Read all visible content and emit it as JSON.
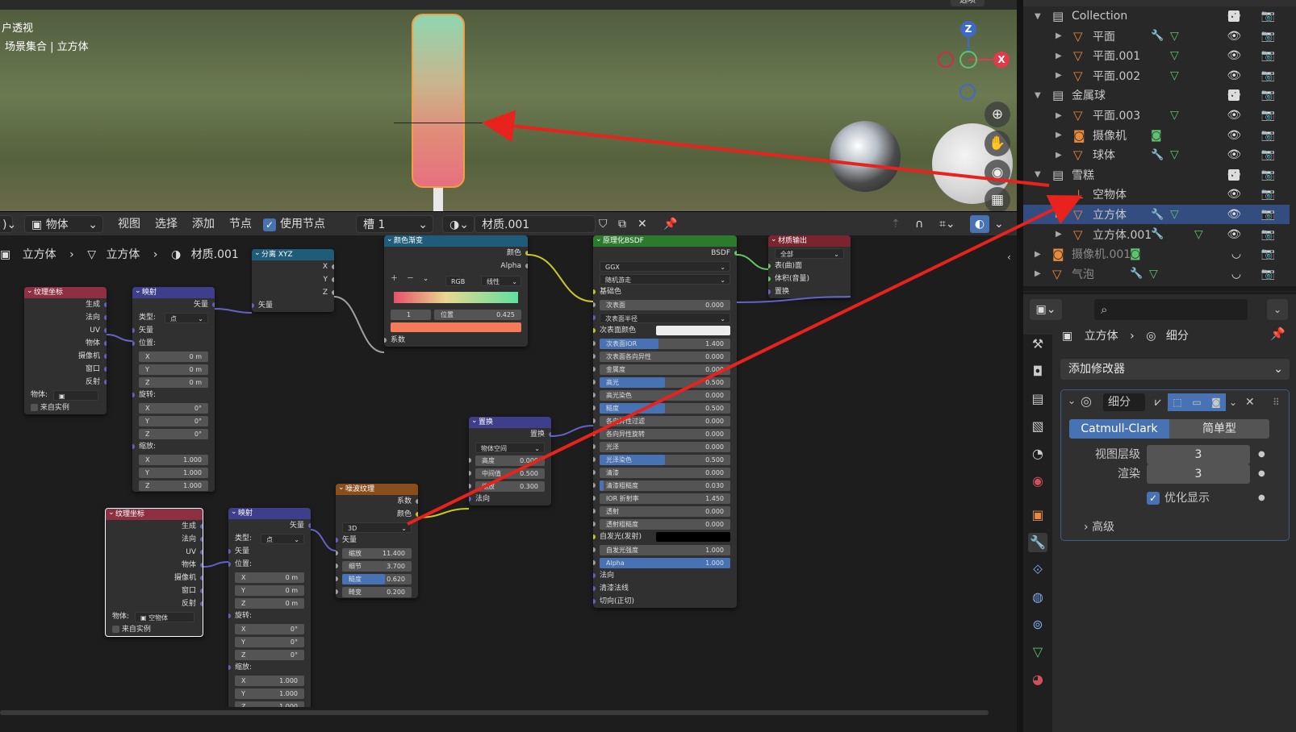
{
  "viewport": {
    "view_name": "户透视",
    "collection_path": "场景集合 | 立方体",
    "top_right_label": "选项",
    "gizmo": {
      "z": "Z",
      "x": "X"
    }
  },
  "outliner": {
    "rows": [
      {
        "name": "Collection",
        "type": "collection"
      },
      {
        "name": "平面",
        "type": "mesh"
      },
      {
        "name": "平面.001",
        "type": "mesh"
      },
      {
        "name": "平面.002",
        "type": "mesh"
      },
      {
        "name": "金属球",
        "type": "collection"
      },
      {
        "name": "平面.003",
        "type": "mesh"
      },
      {
        "name": "摄像机",
        "type": "camera"
      },
      {
        "name": "球体",
        "type": "mesh"
      },
      {
        "name": "雪糕",
        "type": "collection"
      },
      {
        "name": "空物体",
        "type": "empty"
      },
      {
        "name": "立方体",
        "type": "mesh",
        "selected": true
      },
      {
        "name": "立方体.001",
        "type": "mesh"
      },
      {
        "name": "摄像机.001",
        "type": "camera",
        "dim": true
      },
      {
        "name": "气泡",
        "type": "mesh",
        "dim": true
      }
    ]
  },
  "properties": {
    "breadcrumb_object": "立方体",
    "breadcrumb_modifier": "细分",
    "add_modifier": "添加修改器",
    "modifier_name": "细分",
    "mode_catmull": "Catmull-Clark",
    "mode_simple": "简单型",
    "viewport_levels_label": "视图层级",
    "viewport_levels_value": "3",
    "render_label": "渲染",
    "render_value": "3",
    "optimal_display": "优化显示",
    "advanced": "高级"
  },
  "node_header": {
    "object_mode": "物体",
    "menu": [
      "视图",
      "选择",
      "添加",
      "节点"
    ],
    "use_nodes": "使用节点",
    "slot": "槽 1",
    "material": "材质.001"
  },
  "breadcrumb": {
    "a": "立方体",
    "b": "立方体",
    "c": "材质.001"
  },
  "nodes": {
    "tex_coord1": {
      "title": "纹理坐标",
      "outputs": [
        "生成",
        "法向",
        "UV",
        "物体",
        "摄像机",
        "窗口",
        "反射"
      ],
      "object_label": "物体:",
      "from_instancer": "来自实例"
    },
    "mapping1": {
      "title": "映射",
      "out": "矢量",
      "type_label": "类型:",
      "type_value": "点",
      "in_vec": "矢量",
      "location": "位置:",
      "loc": [
        "0 m",
        "0 m",
        "0 m"
      ],
      "rotation": "旋转:",
      "rot": [
        "0°",
        "0°",
        "0°"
      ],
      "scale": "缩放:",
      "scl": [
        "1.000",
        "1.000",
        "1.000"
      ]
    },
    "sep_xyz": {
      "title": "分离 XYZ",
      "outs": [
        "X",
        "Y",
        "Z"
      ],
      "in": "矢量"
    },
    "color_ramp": {
      "title": "颜色渐变",
      "out_color": "颜色",
      "out_alpha": "Alpha",
      "mode": "RGB",
      "interp": "线性",
      "index": "1",
      "pos_label": "位置",
      "pos_value": "0.425",
      "in": "系数"
    },
    "bsdf": {
      "title": "原理化BSDF",
      "out": "BSDF",
      "dist": "GGX",
      "sss_method": "随机游走",
      "base_color": "基础色",
      "fields": [
        {
          "k": "次表面",
          "v": "0.000",
          "f": 0
        },
        {
          "k": "次表面半径",
          "v": "",
          "f": 0,
          "sel": true
        },
        {
          "k": "次表面颜色",
          "v": "",
          "f": 0,
          "color": "#ededed"
        },
        {
          "k": "次表面IOR",
          "v": "1.400",
          "f": 0.45
        },
        {
          "k": "次表面各向异性",
          "v": "0.000",
          "f": 0
        },
        {
          "k": "金属度",
          "v": "0.000",
          "f": 0
        },
        {
          "k": "高光",
          "v": "0.500",
          "f": 0.5
        },
        {
          "k": "高光染色",
          "v": "0.000",
          "f": 0
        },
        {
          "k": "糙度",
          "v": "0.500",
          "f": 0.5
        },
        {
          "k": "各向异性过滤",
          "v": "0.000",
          "f": 0
        },
        {
          "k": "各向异性旋转",
          "v": "0.000",
          "f": 0
        },
        {
          "k": "光泽",
          "v": "0.000",
          "f": 0
        },
        {
          "k": "光泽染色",
          "v": "0.500",
          "f": 0.5
        },
        {
          "k": "清漆",
          "v": "0.000",
          "f": 0
        },
        {
          "k": "清漆粗糙度",
          "v": "0.030",
          "f": 0.03
        },
        {
          "k": "IOR 折射率",
          "v": "1.450",
          "f": 0
        },
        {
          "k": "透射",
          "v": "0.000",
          "f": 0
        },
        {
          "k": "透射粗糙度",
          "v": "0.000",
          "f": 0
        },
        {
          "k": "自发光(发射)",
          "v": "",
          "f": 0,
          "color": "#000000"
        },
        {
          "k": "自发光强度",
          "v": "1.000",
          "f": 0
        },
        {
          "k": "Alpha",
          "v": "1.000",
          "f": 1
        }
      ],
      "tail": [
        "法向",
        "清漆法线",
        "切向(正切)"
      ]
    },
    "mat_out": {
      "title": "材质输出",
      "target": "全部",
      "ins": [
        "表(曲)面",
        "体积(音量)",
        "置换"
      ]
    },
    "displacement": {
      "title": "置换",
      "out": "置换",
      "space": "物体空间",
      "fields": [
        {
          "k": "高度",
          "v": "0.000"
        },
        {
          "k": "中间值",
          "v": "0.500"
        },
        {
          "k": "缩放",
          "v": "0.300"
        }
      ],
      "in": "法向"
    },
    "noise": {
      "title": "噪波纹理",
      "outs": [
        "系数",
        "颜色"
      ],
      "dim": "3D",
      "in": "矢量",
      "fields": [
        {
          "k": "缩放",
          "v": "11.400",
          "f": 0
        },
        {
          "k": "细节",
          "v": "3.700",
          "f": 0
        },
        {
          "k": "糙度",
          "v": "0.620",
          "f": 0.62
        },
        {
          "k": "畸变",
          "v": "0.200",
          "f": 0
        }
      ]
    },
    "tex_coord2": {
      "title": "纹理坐标",
      "outputs": [
        "生成",
        "法向",
        "UV",
        "物体",
        "摄像机",
        "窗口",
        "反射"
      ],
      "object_label": "物体:",
      "object_value": "空物体",
      "from_instancer": "来自实例"
    },
    "mapping2": {
      "title": "映射",
      "out": "矢量",
      "type_label": "类型:",
      "type_value": "点",
      "in_vec": "矢量",
      "location": "位置:",
      "loc": [
        "0 m",
        "0 m",
        "0 m"
      ],
      "rotation": "旋转:",
      "rot": [
        "0°",
        "0°",
        "0°"
      ],
      "scale": "缩放:",
      "scl": [
        "1.000",
        "1.000",
        "1.000"
      ]
    }
  },
  "colors": {
    "accent": "#4772b3",
    "arrow": "#e8221c",
    "selected_row": "#334d80",
    "socket_yellow": "#c7c729",
    "socket_purple": "#6363c7",
    "socket_gray": "#a1a1a1"
  }
}
